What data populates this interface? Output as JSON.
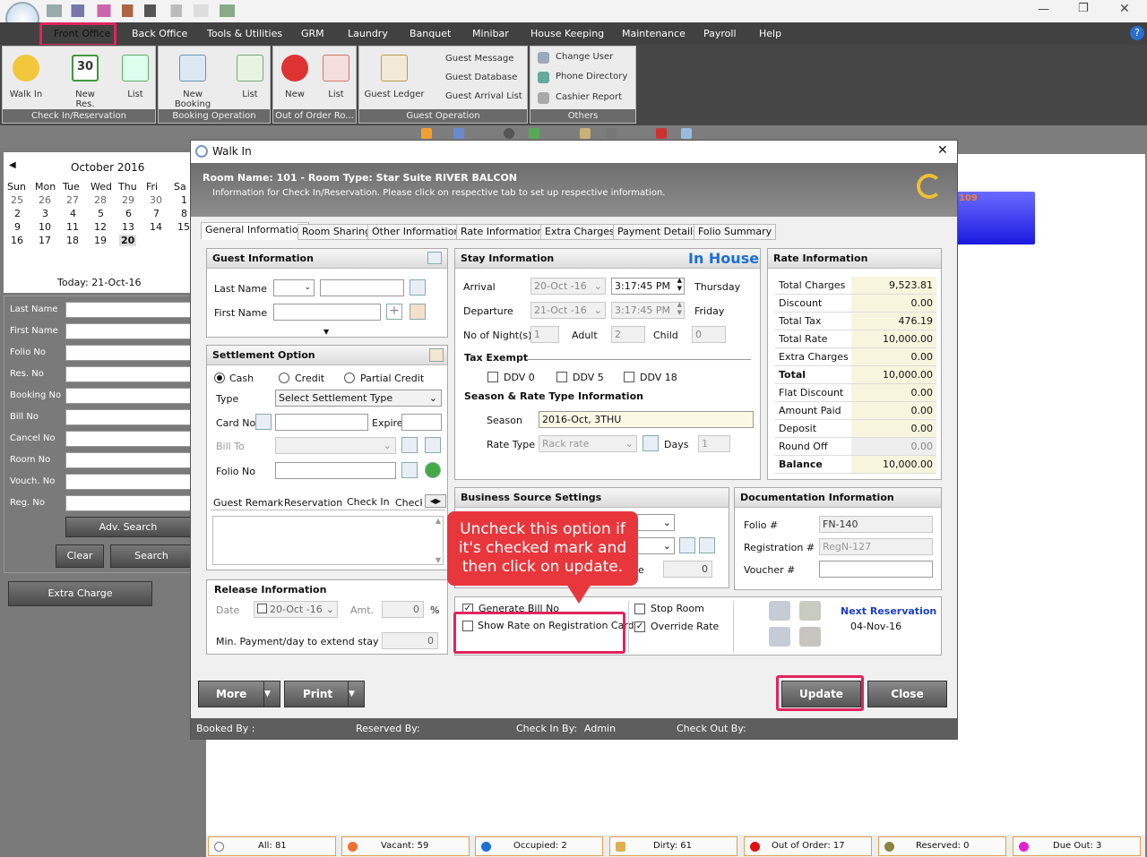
{
  "menu": {
    "items": [
      "Front Office",
      "Back Office",
      "Tools & Utilities",
      "GRM",
      "Laundry",
      "Banquet",
      "Minibar",
      "House Keeping",
      "Maintenance",
      "Payroll",
      "Help"
    ]
  },
  "ribbon": {
    "groups": [
      "Check In/Reservation",
      "Booking Operation",
      "Out of Order Ro...",
      "Guest Operation",
      "Others"
    ],
    "buttons": [
      "Walk In",
      "New Res.",
      "List",
      "New Booking",
      "List",
      "New",
      "List",
      "Guest Ledger"
    ],
    "guest_links": [
      "Guest Message",
      "Guest Database",
      "Guest Arrival List"
    ],
    "other_links": [
      "Change User",
      "Phone Directory",
      "Cashier Report"
    ],
    "calendar_day": "30"
  },
  "calendar": {
    "month": "October 2016",
    "weekdays": [
      "Sun",
      "Mon",
      "Tue",
      "Wed",
      "Thu",
      "Fri",
      "Sa"
    ],
    "rows": [
      [
        "25",
        "26",
        "27",
        "28",
        "29",
        "30",
        "1"
      ],
      [
        "2",
        "3",
        "4",
        "5",
        "6",
        "7",
        "8"
      ],
      [
        "9",
        "10",
        "11",
        "12",
        "13",
        "14",
        "15"
      ],
      [
        "16",
        "17",
        "18",
        "19",
        "20",
        "",
        ""
      ]
    ],
    "today": "Today: 21-Oct-16"
  },
  "search": {
    "labels": [
      "Last Name",
      "First Name",
      "Folio No",
      "Res. No",
      "Booking No",
      "Bill No",
      "Cancel No",
      "Room No",
      "Vouch. No",
      "Reg. No"
    ],
    "adv_search": "Adv. Search",
    "clear": "Clear",
    "search": "Search",
    "extra_charge": "Extra Charge"
  },
  "room_tile": "109",
  "status": {
    "all": "All: 81",
    "vacant": "Vacant: 59",
    "occupied": "Occupied: 2",
    "dirty": "Dirty: 61",
    "ooo": "Out of Order: 17",
    "reserved": "Reserved: 0",
    "dueout": "Due Out: 3"
  },
  "dialog": {
    "title": "Walk In",
    "close": "✕",
    "room_line": "Room Name: 101 - Room Type: Star Suite RIVER BALCON",
    "info_line": "Information for Check In/Reservation. Please click on respective tab to set up respective information.",
    "tabs": [
      "General Information",
      "Room Sharing",
      "Other Information",
      "Rate Information",
      "Extra Charges",
      "Payment Details",
      "Folio Summary"
    ],
    "guest": {
      "title": "Guest Information",
      "last_name": "Last Name",
      "first_name": "First Name"
    },
    "settlement": {
      "title": "Settlement Option",
      "cash": "Cash",
      "credit": "Credit",
      "partial": "Partial Credit",
      "type": "Type",
      "type_value": "Select Settlement Type",
      "card_no": "Card No",
      "expire": "Expire",
      "bill_to": "Bill To",
      "folio_no": "Folio No"
    },
    "remark_tabs": [
      "Guest Remark",
      "Reservation",
      "Check In",
      "Check"
    ],
    "release": {
      "title": "Release Information",
      "date": "Date",
      "date_value": "20-Oct -16",
      "amt": "Amt.",
      "amt_value": "0",
      "pct": "%",
      "min_pay": "Min. Payment/day to extend stay",
      "min_value": "0"
    },
    "stay": {
      "title": "Stay Information",
      "status": "In House",
      "arrival": "Arrival",
      "arrival_date": "20-Oct -16",
      "arrival_time": "3:17:45 PM",
      "arrival_day": "Thursday",
      "departure": "Departure",
      "departure_date": "21-Oct -16",
      "departure_time": "3:17:45 PM",
      "departure_day": "Friday",
      "nights": "No of Night(s)",
      "nights_val": "1",
      "adult": "Adult",
      "adult_val": "2",
      "child": "Child",
      "child_val": "0",
      "tax_exempt": "Tax Exempt",
      "ddv0": "DDV 0",
      "ddv5": "DDV 5",
      "ddv18": "DDV 18",
      "season_title": "Season & Rate Type Information",
      "season": "Season",
      "season_val": "2016-Oct, 3THU",
      "rate_type": "Rate Type",
      "rate_type_val": "Rack rate",
      "days": "Days",
      "days_val": "1"
    },
    "rate": {
      "title": "Rate Information",
      "rows": [
        [
          "Total Charges",
          "9,523.81"
        ],
        [
          "Discount",
          "0.00"
        ],
        [
          "Total Tax",
          "476.19"
        ],
        [
          "Total Rate",
          "10,000.00"
        ],
        [
          "Extra Charges",
          "0.00"
        ],
        [
          "Total",
          "10,000.00"
        ],
        [
          "Flat Discount",
          "0.00"
        ],
        [
          "Amount Paid",
          "0.00"
        ],
        [
          "Deposit",
          "0.00"
        ],
        [
          "Round Off",
          "0.00"
        ],
        [
          "Balance",
          "10,000.00"
        ]
      ]
    },
    "business": {
      "title": "Business Source Settings",
      "e_label": "e",
      "e_val": "0"
    },
    "doc": {
      "title": "Documentation Information",
      "folio": "Folio #",
      "folio_val": "FN-140",
      "reg": "Registration #",
      "reg_val": "RegN-127",
      "voucher": "Voucher #"
    },
    "options": {
      "generate_bill": "Generate Bill No",
      "show_rate": "Show Rate on Registration Card",
      "stop_room": "Stop Room",
      "override_rate": "Override Rate"
    },
    "next_res": {
      "title": "Next Reservation",
      "date": "04-Nov-16"
    },
    "buttons": {
      "more": "More",
      "print": "Print",
      "update": "Update",
      "close": "Close"
    },
    "footer": {
      "booked": "Booked By :",
      "reserved": "Reserved By:",
      "checkin": "Check In By:",
      "checkin_val": "Admin",
      "checkout": "Check Out By:"
    }
  },
  "callout": "Uncheck this option if it's checked mark and then click on update."
}
